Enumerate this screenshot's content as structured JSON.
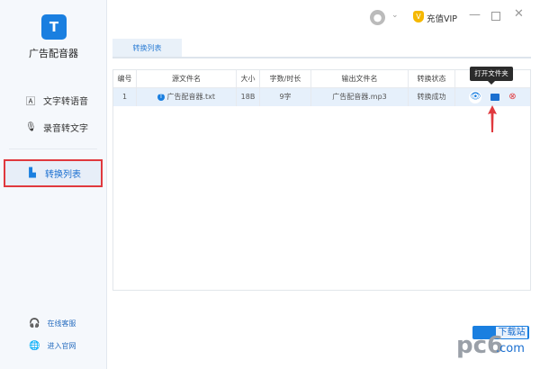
{
  "app": {
    "title": "广告配音器",
    "logo_letter": "T"
  },
  "sidebar": {
    "items": [
      {
        "label": "文字转语音",
        "icon": "text-icon"
      },
      {
        "label": "录音转文字",
        "icon": "mic-icon"
      },
      {
        "label": "转换列表",
        "icon": "file-list-icon"
      }
    ],
    "footer": [
      {
        "label": "在线客服",
        "icon": "support-icon"
      },
      {
        "label": "进入官网",
        "icon": "globe-icon"
      }
    ]
  },
  "titlebar": {
    "vip_label": "充值VIP"
  },
  "main": {
    "tab": "转换列表",
    "table": {
      "headers": [
        "编号",
        "源文件名",
        "大小",
        "字数/时长",
        "输出文件名",
        "转换状态",
        ""
      ],
      "rows": [
        {
          "index": "1",
          "source": "广告配音器.txt",
          "size": "18B",
          "length": "9字",
          "output": "广告配音器.mp3",
          "status": "转换成功"
        }
      ]
    },
    "tooltip": "打开文件夹"
  },
  "watermark": {
    "text": "pc6 下载站 .com"
  },
  "colors": {
    "accent": "#1a7fe0",
    "highlight": "#e0393e"
  }
}
